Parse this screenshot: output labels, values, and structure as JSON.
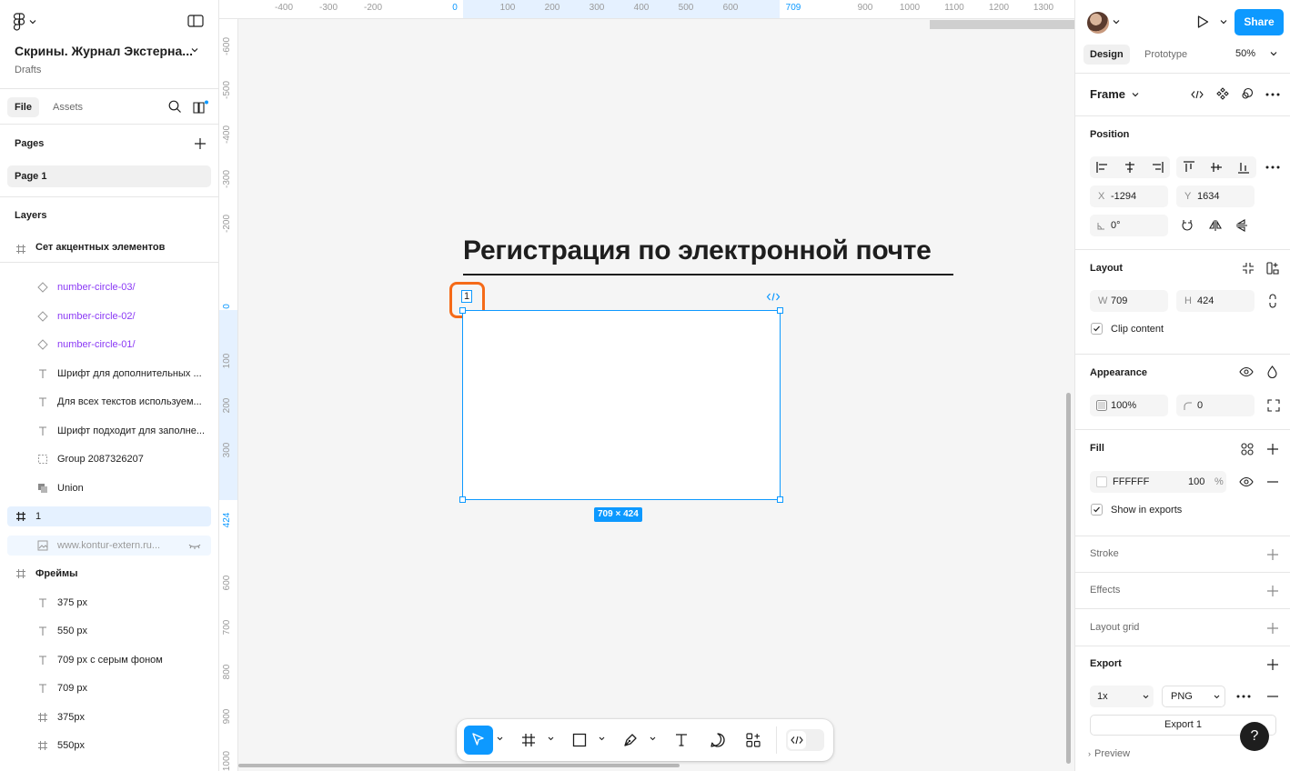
{
  "file": {
    "title": "Скрины. Журнал Экстерна...",
    "location": "Drafts"
  },
  "left_tabs": {
    "file": "File",
    "assets": "Assets"
  },
  "pages": {
    "header": "Pages",
    "items": [
      "Page 1"
    ]
  },
  "layers": {
    "header": "Layers",
    "sticky": "Сет акцентных элементов",
    "items": [
      {
        "label": "number-circle-03/",
        "icon": "component-icon",
        "kind": "comp",
        "indent": 1
      },
      {
        "label": "number-circle-02/",
        "icon": "component-icon",
        "kind": "comp",
        "indent": 1
      },
      {
        "label": "number-circle-01/",
        "icon": "component-icon",
        "kind": "comp",
        "indent": 1
      },
      {
        "label": "Шрифт для дополнительных ...",
        "icon": "text-icon",
        "kind": "",
        "indent": 1
      },
      {
        "label": "Для всех текстов используем...",
        "icon": "text-icon",
        "kind": "",
        "indent": 1
      },
      {
        "label": "Шрифт подходит для заполне...",
        "icon": "text-icon",
        "kind": "",
        "indent": 1
      },
      {
        "label": "Group 2087326207",
        "icon": "group-icon",
        "kind": "",
        "indent": 1
      },
      {
        "label": "Union",
        "icon": "union-icon",
        "kind": "",
        "indent": 1
      },
      {
        "label": "1",
        "icon": "frame-icon",
        "kind": "sel",
        "indent": 0
      },
      {
        "label": "www.kontur-extern.ru...",
        "icon": "image-icon",
        "kind": "sel-child",
        "indent": 1
      },
      {
        "label": "Фреймы",
        "icon": "frame-icon",
        "kind": "bold",
        "indent": 0
      },
      {
        "label": "375 px",
        "icon": "text-icon",
        "kind": "",
        "indent": 1
      },
      {
        "label": "550 px",
        "icon": "text-icon",
        "kind": "",
        "indent": 1
      },
      {
        "label": "709 px с серым фоном",
        "icon": "text-icon",
        "kind": "",
        "indent": 1
      },
      {
        "label": "709 px",
        "icon": "text-icon",
        "kind": "",
        "indent": 1
      },
      {
        "label": "375px",
        "icon": "frame-icon",
        "kind": "",
        "indent": 1
      },
      {
        "label": "550px",
        "icon": "frame-icon",
        "kind": "",
        "indent": 1
      }
    ]
  },
  "ruler_top": {
    "ticks": [
      "-400",
      "-300",
      "-200",
      "0",
      "100",
      "200",
      "300",
      "400",
      "500",
      "600",
      "709",
      "900",
      "1000",
      "1100",
      "1200",
      "1300"
    ]
  },
  "ruler_left": {
    "ticks": [
      "-600",
      "-500",
      "-400",
      "-300",
      "-200",
      "0",
      "100",
      "200",
      "300",
      "424",
      "600",
      "700",
      "800",
      "900",
      "1000"
    ]
  },
  "canvas": {
    "heading": "Регистрация по электронной почте",
    "frame_name": "1",
    "dimensions": "709 × 424"
  },
  "right": {
    "share": "Share",
    "tabs": {
      "design": "Design",
      "prototype": "Prototype"
    },
    "zoom": "50%",
    "selection_type": "Frame",
    "position": {
      "header": "Position",
      "x_label": "X",
      "x": "-1294",
      "y_label": "Y",
      "y": "1634",
      "rotation": "0°"
    },
    "layout": {
      "header": "Layout",
      "w_label": "W",
      "w": "709",
      "h_label": "H",
      "h": "424",
      "clip_content": "Clip content"
    },
    "appearance": {
      "header": "Appearance",
      "opacity": "100%",
      "radius": "0"
    },
    "fill": {
      "header": "Fill",
      "hex": "FFFFFF",
      "opacity": "100",
      "percent": "%",
      "show_in_exports": "Show in exports"
    },
    "stroke": "Stroke",
    "effects": "Effects",
    "layout_grid": "Layout grid",
    "export": {
      "header": "Export",
      "scale": "1x",
      "format": "PNG",
      "button": "Export 1",
      "preview": "Preview"
    },
    "help": "?"
  },
  "colors": {
    "accent": "#0d99ff",
    "highlight": "#f56a18",
    "component": "#8a38f5"
  }
}
